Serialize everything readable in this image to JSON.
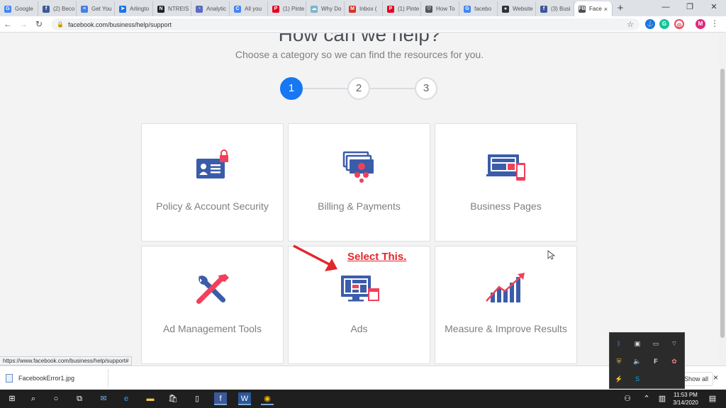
{
  "browser": {
    "tabs": [
      {
        "label": "Google",
        "color": "#4285f4",
        "glyph": "G"
      },
      {
        "label": "(2) Beco",
        "color": "#3b5998",
        "glyph": "f"
      },
      {
        "label": "Get You",
        "color": "#4a7fe0",
        "glyph": "≡"
      },
      {
        "label": "Arlingto",
        "color": "#1a73e8",
        "glyph": "➤"
      },
      {
        "label": "NTREIS",
        "color": "#222222",
        "glyph": "N"
      },
      {
        "label": "Analytic",
        "color": "#5c6bc0",
        "glyph": "◔"
      },
      {
        "label": "All you",
        "color": "#4285f4",
        "glyph": "C"
      },
      {
        "label": "(1) Pinte",
        "color": "#e60023",
        "glyph": "P"
      },
      {
        "label": "Why Do",
        "color": "#7bb4c9",
        "glyph": "☁"
      },
      {
        "label": "Inbox (",
        "color": "#d93025",
        "glyph": "M"
      },
      {
        "label": "(1) Pinte",
        "color": "#e60023",
        "glyph": "P"
      },
      {
        "label": "How To",
        "color": "#555555",
        "glyph": "♡"
      },
      {
        "label": "facebo",
        "color": "#4285f4",
        "glyph": "G"
      },
      {
        "label": "Website",
        "color": "#333333",
        "glyph": "●"
      },
      {
        "label": "(3) Busi",
        "color": "#3b5998",
        "glyph": "f"
      },
      {
        "label": "Face",
        "color": "#4b4f56",
        "glyph": "FB"
      }
    ],
    "active_tab_close": "×",
    "new_tab": "+",
    "window_controls": {
      "minimize": "—",
      "maximize": "❐",
      "close": "✕"
    },
    "nav": {
      "back": "←",
      "forward": "→",
      "reload": "↻"
    },
    "url": "facebook.com/business/help/support",
    "lock_icon": "🔒",
    "bookmark_star": "☆",
    "profile_initial": "M",
    "menu": "⋮",
    "status_url": "https://www.facebook.com/business/help/support#"
  },
  "page": {
    "heading": "How can we help?",
    "subheading": "Choose a category so we can find the resources for you.",
    "steps": [
      "1",
      "2",
      "3"
    ],
    "categories": [
      {
        "label": "Policy & Account Security",
        "icon": "id-card-lock-icon"
      },
      {
        "label": "Billing & Payments",
        "icon": "cards-coins-icon"
      },
      {
        "label": "Business Pages",
        "icon": "monitor-phone-icon"
      },
      {
        "label": "Ad Management Tools",
        "icon": "wrench-screwdriver-icon"
      },
      {
        "label": "Ads",
        "icon": "monitor-ads-icon"
      },
      {
        "label": "Measure & Improve Results",
        "icon": "bar-chart-growth-icon"
      }
    ],
    "annotation": "Select This.",
    "colors": {
      "blue": "#3b5ca9",
      "red": "#f0415a",
      "accent": "#1877f2",
      "annotation": "#e3262b"
    }
  },
  "downloads": {
    "file": "FacebookError1.jpg",
    "show_all": "Show all",
    "close": "×"
  },
  "taskbar": {
    "time": "11:53 PM",
    "date": "3/14/2020"
  }
}
